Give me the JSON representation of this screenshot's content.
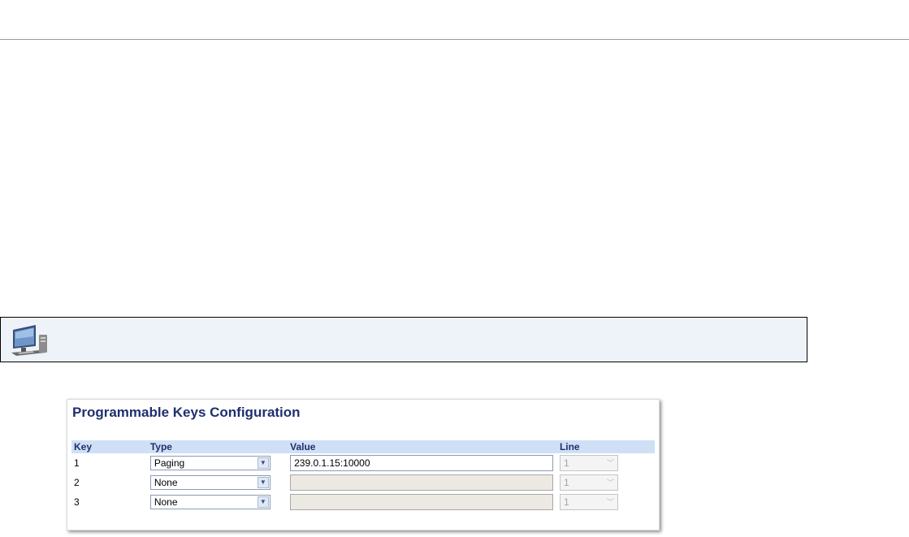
{
  "web_ui_note": {
    "icon": "computer-monitor-icon"
  },
  "config": {
    "title": "Programmable Keys Configuration",
    "columns": {
      "key": "Key",
      "type": "Type",
      "value": "Value",
      "line": "Line"
    },
    "rows": [
      {
        "key": "1",
        "type": "Paging",
        "value": "239.0.1.15:10000",
        "value_enabled": true,
        "line": "1",
        "line_enabled": false
      },
      {
        "key": "2",
        "type": "None",
        "value": "",
        "value_enabled": false,
        "line": "1",
        "line_enabled": false
      },
      {
        "key": "3",
        "type": "None",
        "value": "",
        "value_enabled": false,
        "line": "1",
        "line_enabled": false
      }
    ],
    "colors": {
      "title": "#1f2f6e",
      "header_bg": "#cfe0f6",
      "disabled_input_bg": "#ece9e2"
    }
  }
}
